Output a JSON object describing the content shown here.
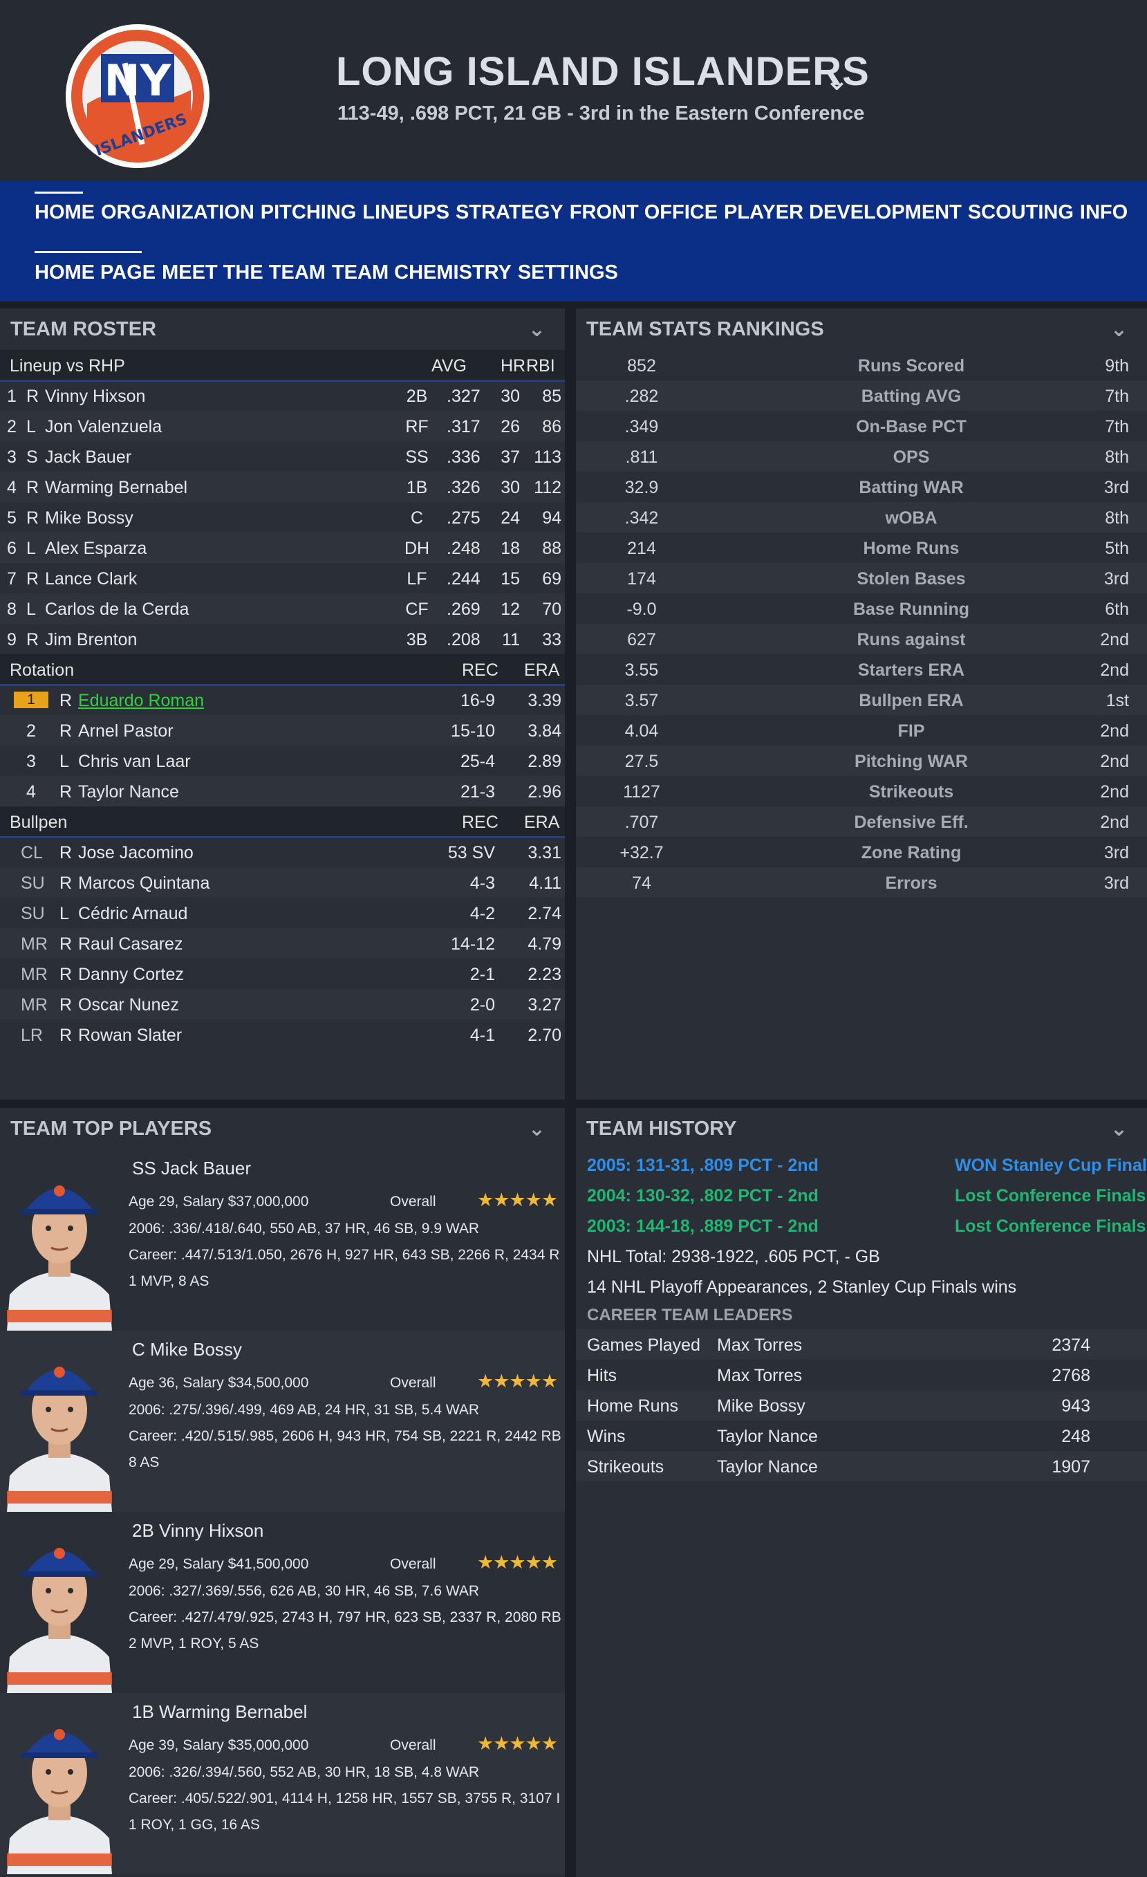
{
  "header": {
    "team_name": "LONG ISLAND ISLANDERS",
    "record": "113-49, .698 PCT, 21 GB - 3rd in the Eastern Conference",
    "logo_text": "NY",
    "logo_sub": "ISLANDERS"
  },
  "nav": {
    "main": [
      "HOME",
      "ORGANIZATION",
      "PITCHING",
      "LINEUPS",
      "STRATEGY",
      "FRONT OFFICE",
      "PLAYER DEVELOPMENT",
      "SCOUTING",
      "INFO"
    ],
    "sub": [
      "HOME PAGE",
      "MEET THE TEAM",
      "TEAM CHEMISTRY",
      "SETTINGS"
    ]
  },
  "roster": {
    "title": "TEAM ROSTER",
    "lineup_header": {
      "label": "Lineup vs RHP",
      "c1": "AVG",
      "c2": "HR",
      "c3": "RBI"
    },
    "lineup": [
      {
        "n": "1",
        "h": "R",
        "name": "Vinny Hixson",
        "pos": "2B",
        "avg": ".327",
        "hr": "30",
        "rbi": "85"
      },
      {
        "n": "2",
        "h": "L",
        "name": "Jon Valenzuela",
        "pos": "RF",
        "avg": ".317",
        "hr": "26",
        "rbi": "86"
      },
      {
        "n": "3",
        "h": "S",
        "name": "Jack Bauer",
        "pos": "SS",
        "avg": ".336",
        "hr": "37",
        "rbi": "113"
      },
      {
        "n": "4",
        "h": "R",
        "name": "Warming Bernabel",
        "pos": "1B",
        "avg": ".326",
        "hr": "30",
        "rbi": "112"
      },
      {
        "n": "5",
        "h": "R",
        "name": "Mike Bossy",
        "pos": "C",
        "avg": ".275",
        "hr": "24",
        "rbi": "94"
      },
      {
        "n": "6",
        "h": "L",
        "name": "Alex Esparza",
        "pos": "DH",
        "avg": ".248",
        "hr": "18",
        "rbi": "88"
      },
      {
        "n": "7",
        "h": "R",
        "name": "Lance Clark",
        "pos": "LF",
        "avg": ".244",
        "hr": "15",
        "rbi": "69"
      },
      {
        "n": "8",
        "h": "L",
        "name": "Carlos de la Cerda",
        "pos": "CF",
        "avg": ".269",
        "hr": "12",
        "rbi": "70"
      },
      {
        "n": "9",
        "h": "R",
        "name": "Jim Brenton",
        "pos": "3B",
        "avg": ".208",
        "hr": "11",
        "rbi": "33"
      }
    ],
    "rotation_header": {
      "label": "Rotation",
      "c1": "REC",
      "c2": "ERA"
    },
    "rotation": [
      {
        "n": "1",
        "h": "R",
        "name": "Eduardo Roman",
        "rec": "16-9",
        "era": "3.39",
        "highlight": true
      },
      {
        "n": "2",
        "h": "R",
        "name": "Arnel Pastor",
        "rec": "15-10",
        "era": "3.84"
      },
      {
        "n": "3",
        "h": "L",
        "name": "Chris van Laar",
        "rec": "25-4",
        "era": "2.89"
      },
      {
        "n": "4",
        "h": "R",
        "name": "Taylor Nance",
        "rec": "21-3",
        "era": "2.96"
      }
    ],
    "bullpen_header": {
      "label": "Bullpen",
      "c1": "REC",
      "c2": "ERA"
    },
    "bullpen": [
      {
        "role": "CL",
        "h": "R",
        "name": "Jose Jacomino",
        "rec": "53 SV",
        "era": "3.31"
      },
      {
        "role": "SU",
        "h": "R",
        "name": "Marcos Quintana",
        "rec": "4-3",
        "era": "4.11"
      },
      {
        "role": "SU",
        "h": "L",
        "name": "Cédric Arnaud",
        "rec": "4-2",
        "era": "2.74"
      },
      {
        "role": "MR",
        "h": "R",
        "name": "Raul Casarez",
        "rec": "14-12",
        "era": "4.79"
      },
      {
        "role": "MR",
        "h": "R",
        "name": "Danny Cortez",
        "rec": "2-1",
        "era": "2.23"
      },
      {
        "role": "MR",
        "h": "R",
        "name": "Oscar Nunez",
        "rec": "2-0",
        "era": "3.27"
      },
      {
        "role": "LR",
        "h": "R",
        "name": "Rowan Slater",
        "rec": "4-1",
        "era": "2.70"
      }
    ]
  },
  "stats": {
    "title": "TEAM STATS RANKINGS",
    "rows": [
      {
        "value": "852",
        "label": "Runs Scored",
        "rank": "9th"
      },
      {
        "value": ".282",
        "label": "Batting AVG",
        "rank": "7th"
      },
      {
        "value": ".349",
        "label": "On-Base PCT",
        "rank": "7th"
      },
      {
        "value": ".811",
        "label": "OPS",
        "rank": "8th"
      },
      {
        "value": "32.9",
        "label": "Batting WAR",
        "rank": "3rd"
      },
      {
        "value": ".342",
        "label": "wOBA",
        "rank": "8th"
      },
      {
        "value": "214",
        "label": "Home Runs",
        "rank": "5th"
      },
      {
        "value": "174",
        "label": "Stolen Bases",
        "rank": "3rd"
      },
      {
        "value": "-9.0",
        "label": "Base Running",
        "rank": "6th"
      },
      {
        "value": "627",
        "label": "Runs against",
        "rank": "2nd"
      },
      {
        "value": "3.55",
        "label": "Starters ERA",
        "rank": "2nd"
      },
      {
        "value": "3.57",
        "label": "Bullpen ERA",
        "rank": "1st"
      },
      {
        "value": "4.04",
        "label": "FIP",
        "rank": "2nd"
      },
      {
        "value": "27.5",
        "label": "Pitching WAR",
        "rank": "2nd"
      },
      {
        "value": "1127",
        "label": "Strikeouts",
        "rank": "2nd"
      },
      {
        "value": ".707",
        "label": "Defensive Eff.",
        "rank": "2nd"
      },
      {
        "value": "+32.7",
        "label": "Zone Rating",
        "rank": "3rd"
      },
      {
        "value": "74",
        "label": "Errors",
        "rank": "3rd"
      }
    ]
  },
  "top_players": {
    "title": "TEAM TOP PLAYERS",
    "overall_label": "Overall",
    "stars": "★★★★★",
    "players": [
      {
        "name": "SS Jack Bauer",
        "age_salary": "Age 29, Salary $37,000,000",
        "season": "2006: .336/.418/.640, 550 AB, 37 HR, 46 SB, 9.9 WAR",
        "career": "Career: .447/.513/1.050, 2676 H, 927 HR, 643 SB, 2266 R, 2434 R",
        "awards": "1 MVP, 8 AS",
        "flag": "usa-flag-icon"
      },
      {
        "name": "C Mike Bossy",
        "age_salary": "Age 36, Salary $34,500,000",
        "season": "2006: .275/.396/.499, 469 AB, 24 HR, 31 SB, 5.4 WAR",
        "career": "Career: .420/.515/.985, 2606 H, 943 HR, 754 SB, 2221 R, 2442 RB",
        "awards": "8 AS",
        "flag": "canada-flag-icon"
      },
      {
        "name": "2B Vinny Hixson",
        "age_salary": "Age 29, Salary $41,500,000",
        "season": "2006: .327/.369/.556, 626 AB, 30 HR, 46 SB, 7.6 WAR",
        "career": "Career: .427/.479/.925, 2743 H, 797 HR, 623 SB, 2337 R, 2080 RB",
        "awards": "2 MVP, 1 ROY, 5 AS",
        "flag": "usa-flag-icon"
      },
      {
        "name": "1B Warming Bernabel",
        "age_salary": "Age 39, Salary $35,000,000",
        "season": "2006: .326/.394/.560, 552 AB, 30 HR, 18 SB, 4.8 WAR",
        "career": "Career: .405/.522/.901, 4114 H, 1258 HR, 1557 SB, 3755 R, 3107 I",
        "awards": "1 ROY, 1 GG, 16 AS",
        "flag": "dominican-flag-icon"
      }
    ]
  },
  "history": {
    "title": "TEAM HISTORY",
    "seasons": [
      {
        "text": "2005: 131-31, .809 PCT - 2nd",
        "result": "WON Stanley Cup Finals",
        "color": "#2f8fe8"
      },
      {
        "text": "2004: 130-32, .802 PCT - 2nd",
        "result": "Lost Conference Finals",
        "color": "#22b573"
      },
      {
        "text": "2003: 144-18, .889 PCT - 2nd",
        "result": "Lost Conference Finals",
        "color": "#22b573"
      }
    ],
    "total": "NHL Total: 2938-1922, .605 PCT, - GB",
    "playoffs": "14 NHL Playoff Appearances, 2 Stanley Cup Finals wins",
    "leaders_title": "CAREER TEAM LEADERS",
    "leaders": [
      {
        "cat": "Games Played",
        "name": "Max Torres",
        "val": "2374"
      },
      {
        "cat": "Hits",
        "name": "Max Torres",
        "val": "2768"
      },
      {
        "cat": "Home Runs",
        "name": "Mike Bossy",
        "val": "943"
      },
      {
        "cat": "Wins",
        "name": "Taylor Nance",
        "val": "248"
      },
      {
        "cat": "Strikeouts",
        "name": "Taylor Nance",
        "val": "1907"
      }
    ]
  }
}
